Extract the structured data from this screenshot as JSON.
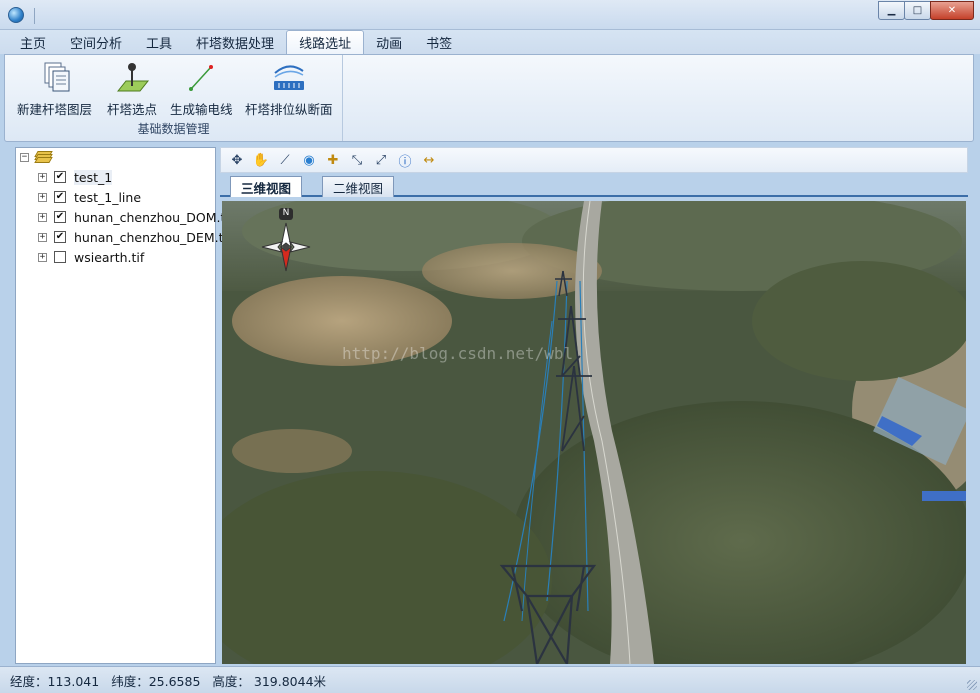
{
  "window": {
    "minimize_glyph": "▁",
    "maximize_glyph": "□",
    "close_glyph": "✕"
  },
  "ribbon_tabs": [
    {
      "label": "主页"
    },
    {
      "label": "空间分析"
    },
    {
      "label": "工具"
    },
    {
      "label": "杆塔数据处理"
    },
    {
      "label": "线路选址",
      "active": true
    },
    {
      "label": "动画"
    },
    {
      "label": "书签"
    }
  ],
  "ribbon": {
    "group_label": "基础数据管理",
    "buttons": [
      {
        "label": "新建杆塔图层",
        "icon": "new-layer-icon"
      },
      {
        "label": "杆塔选点",
        "icon": "pick-point-icon"
      },
      {
        "label": "生成输电线",
        "icon": "line-icon"
      },
      {
        "label": "杆塔排位纵断面",
        "icon": "profile-icon"
      }
    ]
  },
  "tree": {
    "root_expander": "⊟",
    "items": [
      {
        "name": "test_1",
        "checked": true,
        "selected": true
      },
      {
        "name": "test_1_line",
        "checked": true
      },
      {
        "name": "hunan_chenzhou_DOM.tif",
        "checked": true
      },
      {
        "name": "hunan_chenzhou_DEM.tif",
        "checked": true
      },
      {
        "name": "wsiearth.tif",
        "checked": false
      }
    ],
    "expander_glyph": "+",
    "check_glyph": "✔"
  },
  "map_toolbar": [
    {
      "icon": "pan-arrows-icon",
      "glyph": "✥"
    },
    {
      "icon": "hand-icon",
      "glyph": "✋"
    },
    {
      "icon": "measure-icon",
      "glyph": "⟋"
    },
    {
      "icon": "globe-icon",
      "glyph": "◉"
    },
    {
      "icon": "full-extent-icon",
      "glyph": "✚"
    },
    {
      "icon": "zoom-in-icon",
      "glyph": "⤡"
    },
    {
      "icon": "zoom-out-icon",
      "glyph": "⤢"
    },
    {
      "icon": "info-icon",
      "glyph": "ⓘ"
    },
    {
      "icon": "distance-icon",
      "glyph": "↔"
    }
  ],
  "view_tabs": [
    {
      "label": "三维视图",
      "active": true
    },
    {
      "label": "二维视图"
    }
  ],
  "compass": {
    "north_label": "N"
  },
  "watermark": "http://blog.csdn.net/wbl",
  "status": {
    "longitude": "经度：113.041",
    "latitude": "纬度：25.6585",
    "altitude": "高度： 319.8044米"
  },
  "colors": {
    "accent": "#3c6ea8",
    "ribbon_bg": "#dde8f5",
    "close_red": "#c5412a"
  }
}
